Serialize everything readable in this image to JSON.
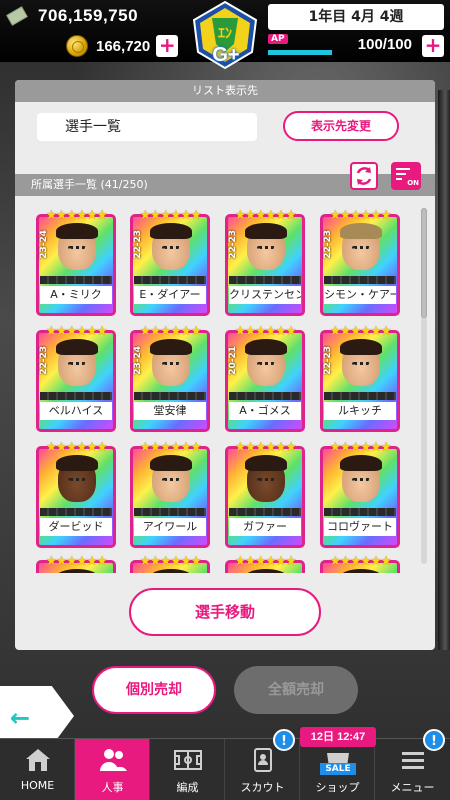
{
  "topbar": {
    "money": "706,159,750",
    "coins": "166,720",
    "grade": "G+",
    "week": "1年目 4月 4週",
    "ap_label": "AP",
    "ap_value": "100/100",
    "ap_fill": 1.0,
    "plus": "+"
  },
  "panel": {
    "list_dest_header": "リスト表示先",
    "dest_value": "選手一覧",
    "change_dest_button": "表示先変更",
    "owned_header": "所属選手一覧 (41/250)",
    "filter_on": "ON",
    "move_button": "選手移動"
  },
  "players": [
    {
      "name": "A・ミリク",
      "season": "23-24",
      "skin": "light"
    },
    {
      "name": "E・ダイアー",
      "season": "22-23",
      "skin": "light"
    },
    {
      "name": "クリステンセン",
      "season": "22-23",
      "skin": "light"
    },
    {
      "name": "シモン・ケアー",
      "season": "22-23",
      "skin": "blond"
    },
    {
      "name": "ベルハイス",
      "season": "22-23",
      "skin": "light"
    },
    {
      "name": "堂安律",
      "season": "23-24",
      "skin": "light"
    },
    {
      "name": "A・ゴメス",
      "season": "20-21",
      "skin": "light"
    },
    {
      "name": "ルキッチ",
      "season": "22-23",
      "skin": "light"
    },
    {
      "name": "ダービッド",
      "season": "",
      "skin": "dark"
    },
    {
      "name": "アイワール",
      "season": "",
      "skin": "light"
    },
    {
      "name": "ガファー",
      "season": "",
      "skin": "dark"
    },
    {
      "name": "コロヴァート",
      "season": "",
      "skin": "light"
    },
    {
      "name": "",
      "season": "",
      "skin": "light"
    },
    {
      "name": "",
      "season": "",
      "skin": "light"
    },
    {
      "name": "",
      "season": "",
      "skin": "light"
    },
    {
      "name": "",
      "season": "",
      "skin": "light"
    }
  ],
  "stars": "★★★★★★",
  "sell": {
    "individual": "個別売却",
    "all": "全額売却"
  },
  "back_arrow": "←",
  "nav": [
    {
      "label": "HOME",
      "icon": "home-icon",
      "badge": ""
    },
    {
      "label": "人事",
      "icon": "people-icon",
      "badge": ""
    },
    {
      "label": "編成",
      "icon": "pitch-icon",
      "badge": ""
    },
    {
      "label": "スカウト",
      "icon": "scout-icon",
      "badge": "!"
    },
    {
      "label": "ショップ",
      "icon": "shop-icon",
      "badge": ""
    },
    {
      "label": "メニュー",
      "icon": "menu-icon",
      "badge": "!"
    }
  ],
  "shop_timer": "12日 12:47",
  "shop_sale_tag": "SALE",
  "colors": {
    "accent": "#e8197f",
    "ap_bar": "#1ec4e0",
    "badge": "#1e8ee8"
  }
}
